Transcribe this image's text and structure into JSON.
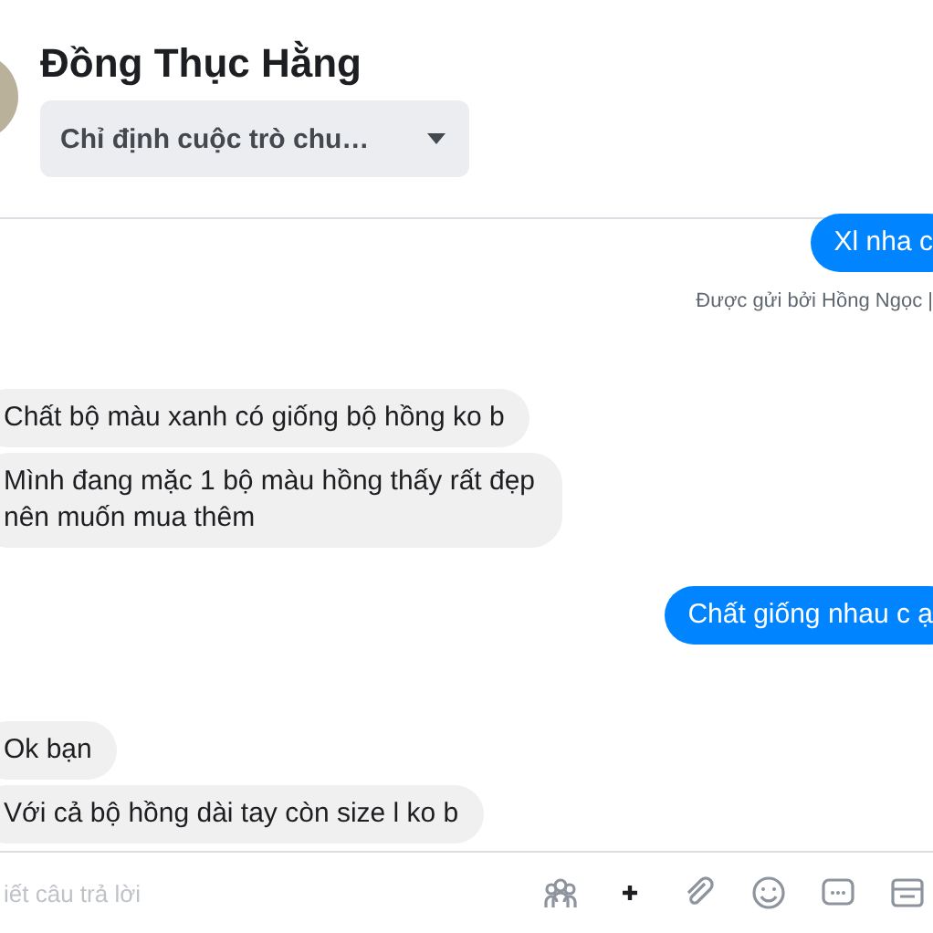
{
  "contact": {
    "name": "Đồng Thục Hằng",
    "assign_menu": "Chỉ định cuộc trò chu…"
  },
  "messages": [
    {
      "kind": "outgoing",
      "text": "Xl nha c"
    },
    {
      "kind": "sent_by",
      "text": "Được gửi bởi Hồng Ngọc |"
    },
    {
      "kind": "incoming",
      "text": "Chất bộ màu xanh có giống bộ hồng ko b"
    },
    {
      "kind": "incoming",
      "text": "Mình đang mặc 1 bộ màu hồng thấy rất đẹp nên muốn mua thêm"
    },
    {
      "kind": "outgoing",
      "text": "Chất giống nhau c ạ"
    },
    {
      "kind": "incoming",
      "text": "Ok bạn"
    },
    {
      "kind": "incoming",
      "text": "Với cả bộ hồng dài tay còn size l ko b"
    }
  ],
  "composer": {
    "placeholder": "iết câu trả lời"
  }
}
